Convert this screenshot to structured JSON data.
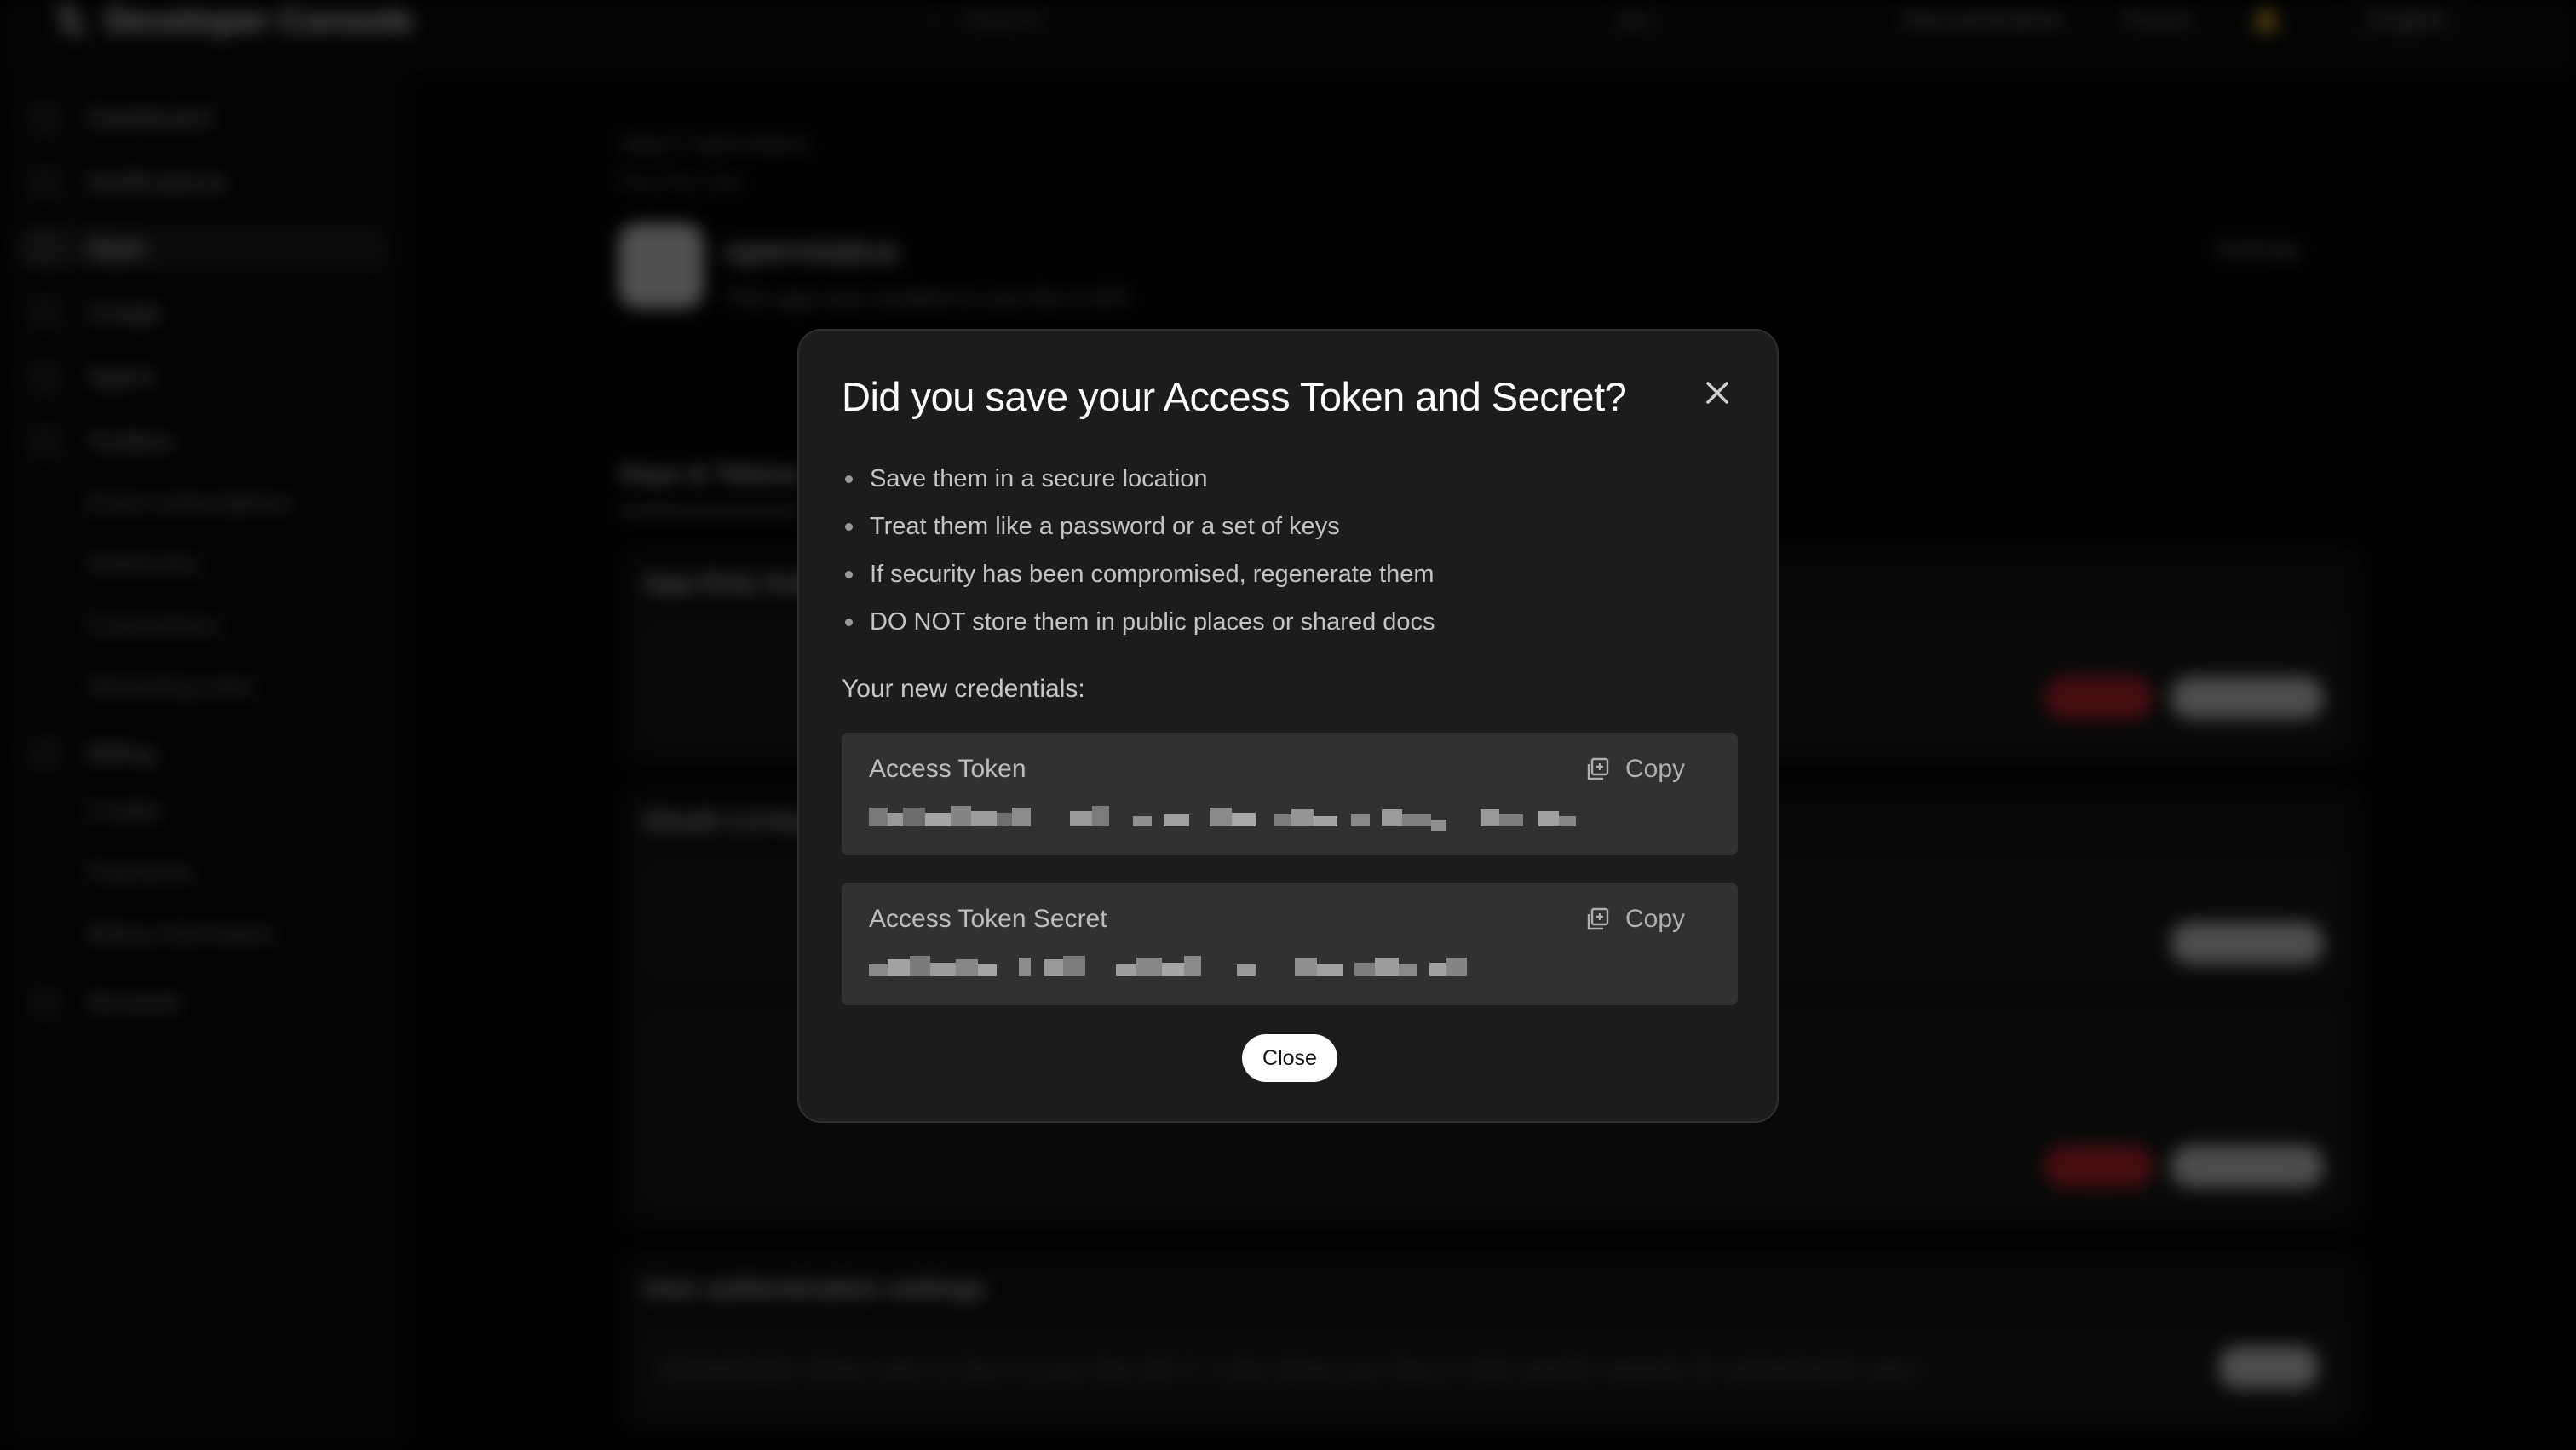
{
  "background": {
    "brand": "Developer Console",
    "search_placeholder": "Search",
    "shortcut": "⌘K",
    "topnav": [
      "Documentation",
      "Forum"
    ],
    "language": "English",
    "sidebar": [
      "Dashboard",
      "Notifications",
      "Apps",
      "Usage",
      "Agent",
      "Toolbox",
      "Billing",
      "Account"
    ],
    "toolbox_sub": [
      "Event subscriptions",
      "Webhooks",
      "Connections",
      "Streaming rules"
    ],
    "billing_sub": [
      "Credits",
      "Payments",
      "Billing information"
    ],
    "breadcrumb": "Apps / openstatus",
    "plan": "Pay Per Use",
    "app_name": "openstatus",
    "app_description": "This app was created to use the X API.",
    "settings": "Settings",
    "tab": "Keys & Tokens",
    "sections": [
      "App-Only Authentication",
      "OAuth 1.0 Keys",
      "User authentication settings"
    ],
    "auth_text": "Authentication allows users to log in to your App with X. It also allows your App to make specific requests for authenticated users."
  },
  "modal": {
    "title": "Did you save your Access Token and Secret?",
    "tips": [
      "Save them in a secure location",
      "Treat them like a password or a set of keys",
      "If security has been compromised, regenerate them",
      "DO NOT store them in public places or shared docs"
    ],
    "credentials_heading": "Your new credentials:",
    "credentials": [
      {
        "label": "Access Token",
        "copy": "Copy"
      },
      {
        "label": "Access Token Secret",
        "copy": "Copy"
      }
    ],
    "close_label": "Close"
  }
}
